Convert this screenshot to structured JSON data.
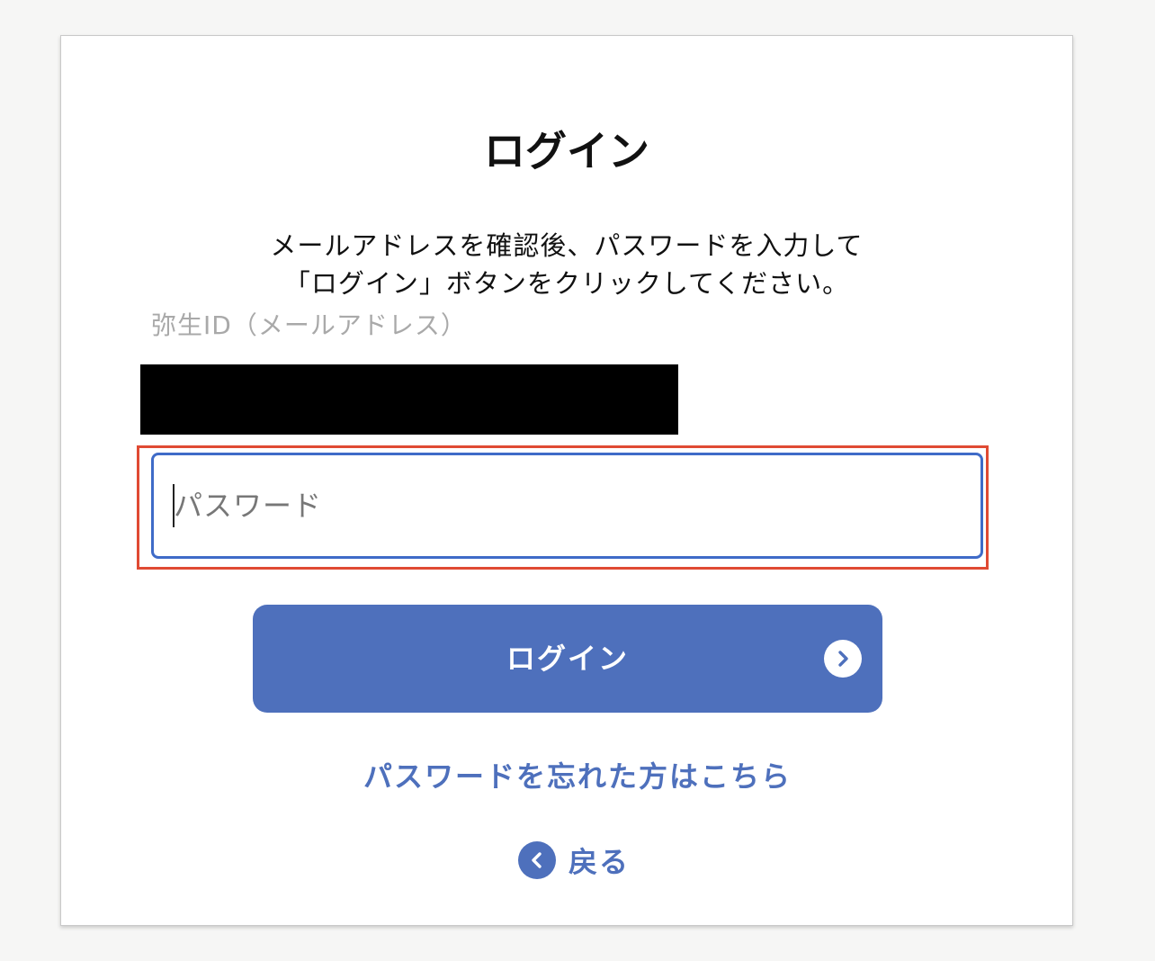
{
  "page": {
    "title": "ログイン",
    "instructions": [
      "メールアドレスを確認後、パスワードを入力して",
      "「ログイン」ボタンをクリックしてください。"
    ]
  },
  "email": {
    "label": "弥生ID（メールアドレス）",
    "value_redacted": true
  },
  "password": {
    "placeholder": "パスワード",
    "value": ""
  },
  "login_button": {
    "label": "ログイン",
    "icon": "chevron-right-icon"
  },
  "forgot_password": {
    "label": "パスワードを忘れた方はこちら"
  },
  "back": {
    "label": "戻る",
    "icon": "chevron-left-icon"
  },
  "colors": {
    "accent": "#4e70bc",
    "input_focus_border": "#3f6bc8",
    "highlight_outline": "#e04a33",
    "background": "#f6f6f5"
  }
}
